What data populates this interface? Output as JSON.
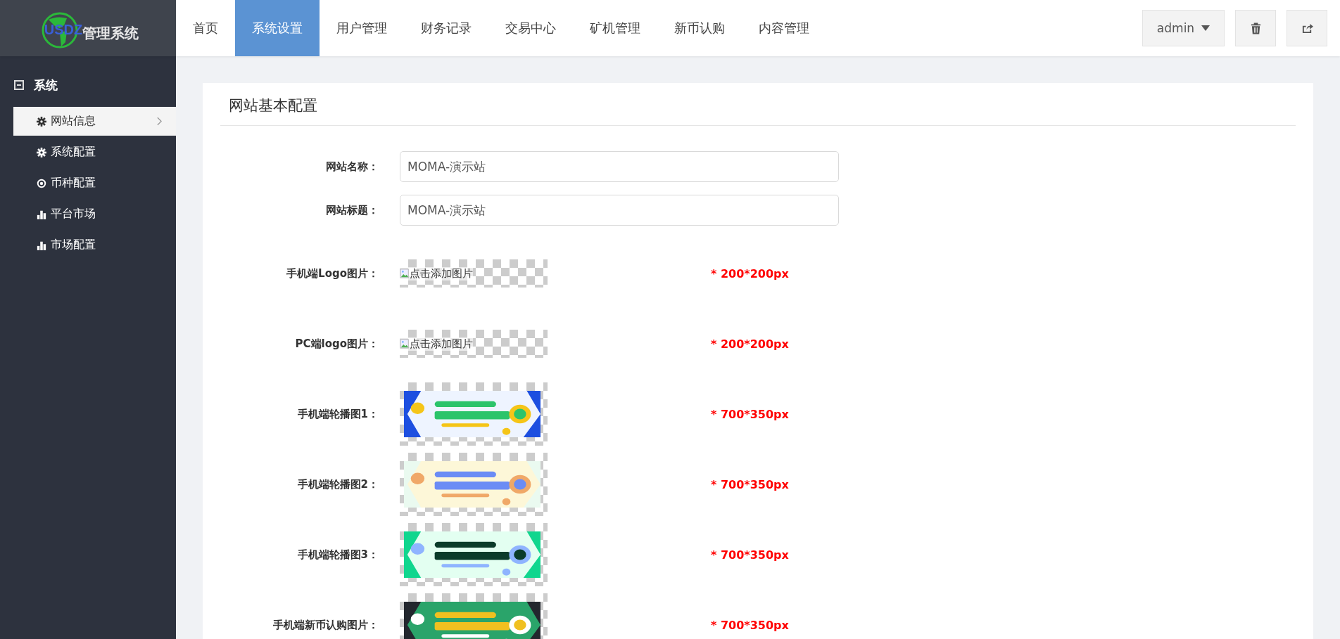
{
  "logo": {
    "brand": "USDZ",
    "title": "管理系统"
  },
  "nav": [
    {
      "label": "首页",
      "selected": false
    },
    {
      "label": "系统设置",
      "selected": true
    },
    {
      "label": "用户管理",
      "selected": false
    },
    {
      "label": "财务记录",
      "selected": false
    },
    {
      "label": "交易中心",
      "selected": false
    },
    {
      "label": "矿机管理",
      "selected": false
    },
    {
      "label": "新币认购",
      "selected": false
    },
    {
      "label": "内容管理",
      "selected": false
    }
  ],
  "user_menu": {
    "label": "admin"
  },
  "sidebar": {
    "group": {
      "label": "系统",
      "expanded": true
    },
    "items": [
      {
        "label": "网站信息",
        "kind": "gear",
        "selected": true
      },
      {
        "label": "系统配置",
        "kind": "gear",
        "selected": false
      },
      {
        "label": "币种配置",
        "kind": "target",
        "selected": false
      },
      {
        "label": "平台市场",
        "kind": "bars",
        "selected": false
      },
      {
        "label": "市场配置",
        "kind": "bars",
        "selected": false
      }
    ]
  },
  "form": {
    "title": "网站基本配置",
    "rows": [
      {
        "kind": "text",
        "label": "网站名称：",
        "value": "MOMA-演示站"
      },
      {
        "kind": "text",
        "label": "网站标题：",
        "value": "MOMA-演示站"
      },
      {
        "kind": "empty_image",
        "label": "手机端Logo图片：",
        "alt": "点击添加图片",
        "hint": "* 200*200px"
      },
      {
        "kind": "empty_image",
        "label": "PC端logo图片：",
        "alt": "点击添加图片",
        "hint": "* 200*200px"
      },
      {
        "kind": "picture",
        "label": "手机端轮播图1：",
        "hint": "* 700*350px"
      },
      {
        "kind": "picture",
        "label": "手机端轮播图2：",
        "hint": "* 700*350px"
      },
      {
        "kind": "picture",
        "label": "手机端轮播图3：",
        "hint": "* 700*350px"
      },
      {
        "kind": "picture",
        "label": "手机端新币认购图片：",
        "hint": "* 700*350px"
      }
    ]
  }
}
